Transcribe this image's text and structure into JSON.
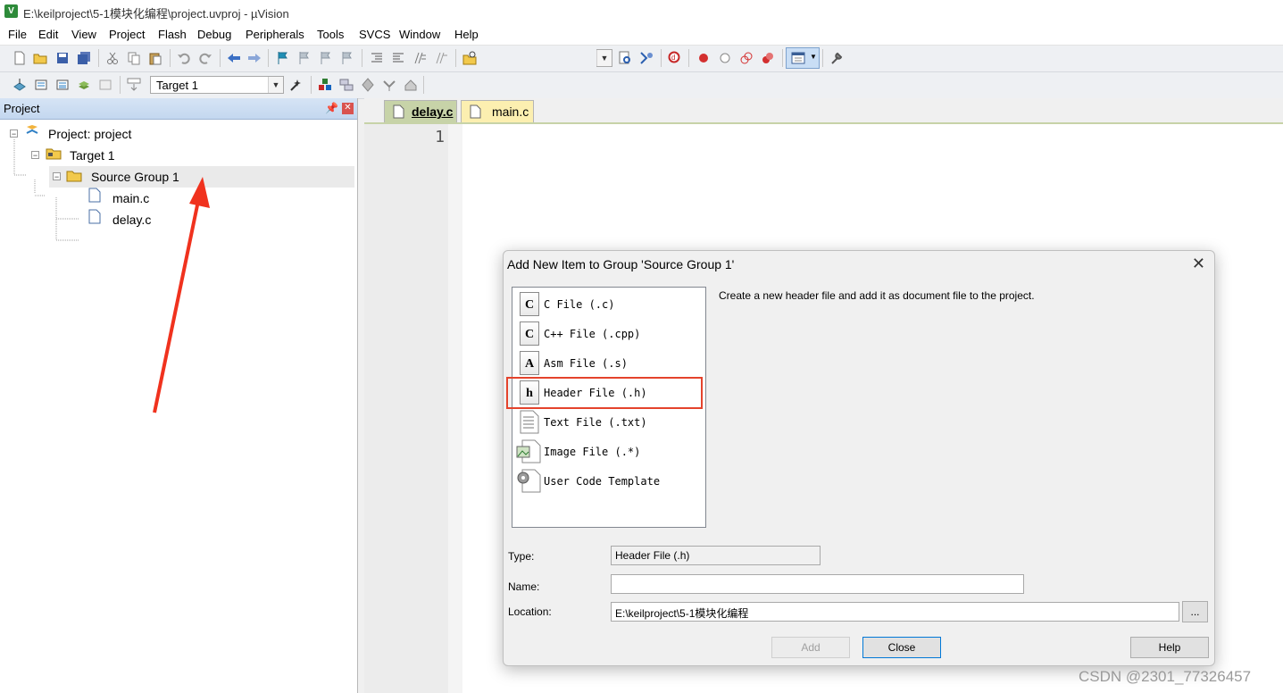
{
  "window": {
    "title": "E:\\keilproject\\5-1模块化编程\\project.uvproj - µVision",
    "app_icon_letter": "V"
  },
  "menu": [
    "File",
    "Edit",
    "View",
    "Project",
    "Flash",
    "Debug",
    "Peripherals",
    "Tools",
    "SVCS",
    "Window",
    "Help"
  ],
  "toolbar2": {
    "target_select": "Target 1"
  },
  "project_pane": {
    "title": "Project",
    "tree": {
      "root": "Project: project",
      "target": "Target 1",
      "group": "Source Group 1",
      "files": [
        "main.c",
        "delay.c"
      ]
    }
  },
  "editor": {
    "tabs": [
      {
        "label": "delay.c",
        "active": true
      },
      {
        "label": "main.c",
        "active": false
      }
    ],
    "line_numbers": [
      "1"
    ]
  },
  "dialog": {
    "title": "Add New Item to Group 'Source Group 1'",
    "items": [
      {
        "label": "C File (.c)",
        "icon": "c-file-icon",
        "glyph": "C"
      },
      {
        "label": "C++ File (.cpp)",
        "icon": "cpp-file-icon",
        "glyph": "C"
      },
      {
        "label": "Asm File (.s)",
        "icon": "asm-file-icon",
        "glyph": "A"
      },
      {
        "label": "Header File (.h)",
        "icon": "header-file-icon",
        "glyph": "h"
      },
      {
        "label": "Text File (.txt)",
        "icon": "text-file-icon",
        "glyph": ""
      },
      {
        "label": "Image File (.*)",
        "icon": "image-file-icon",
        "glyph": ""
      },
      {
        "label": "User Code Template",
        "icon": "template-icon",
        "glyph": ""
      }
    ],
    "selected_index": 3,
    "description": "Create a new header file and add it as document file to the project.",
    "type_label": "Type:",
    "type_value": "Header File (.h)",
    "name_label": "Name:",
    "name_value": "",
    "location_label": "Location:",
    "location_value": "E:\\keilproject\\5-1模块化编程",
    "browse_label": "...",
    "add_label": "Add",
    "close_label": "Close",
    "help_label": "Help"
  },
  "annotations": {
    "highlight_color": "#e4432c",
    "arrow_color": "#f0321e"
  },
  "watermark": "CSDN @2301_77326457"
}
